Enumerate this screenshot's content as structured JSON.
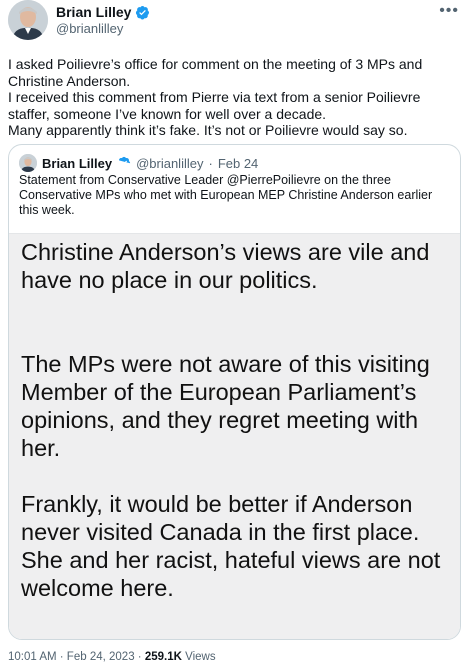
{
  "author": {
    "name": "Brian Lilley",
    "handle": "@brianlilley",
    "verified_color": "#1d9bf0"
  },
  "tweet": {
    "lines": [
      "I asked Poilievre’s office for comment on the meeting of 3 MPs and Christine Anderson.",
      "I received this comment from Pierre via text from a senior Poilievre staffer, someone I’ve known for well over a decade.",
      "Many apparently think it’s fake. It’s not or Poilievre would say so."
    ]
  },
  "quoted": {
    "name": "Brian Lilley",
    "handle": "@brianlilley",
    "dot": "·",
    "date": "Feb 24",
    "text": "Statement from Conservative Leader @PierrePoilievre on the three Conservative MPs who met with European MEP Christine Anderson earlier this week.",
    "image_paragraphs": [
      "Christine Anderson’s views are vile and have no place in our politics.",
      "The MPs were not aware of this visiting Member of the European Parliament’s opinions, and they regret meeting with her.",
      "Frankly, it would be better if Anderson never visited Canada in the first place. She and her racist, hateful views are not welcome here."
    ]
  },
  "footer": {
    "time_date": "10:01 AM · Feb 24, 2023 · ",
    "views_count": "259.1K",
    "views_label": " Views"
  },
  "icons": {
    "more": "more-icon",
    "verified": "verified-badge-icon"
  }
}
